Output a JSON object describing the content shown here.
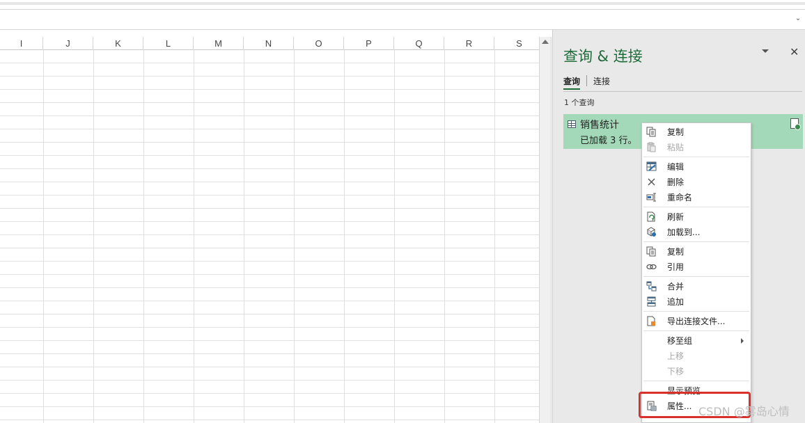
{
  "columns": [
    "I",
    "J",
    "K",
    "L",
    "M",
    "N",
    "O",
    "P",
    "Q",
    "R",
    "S"
  ],
  "pane": {
    "title": "查询 & 连接",
    "tab_queries": "查询",
    "tab_connections": "连接",
    "query_count": "1 个查询",
    "query": {
      "name": "销售统计",
      "status": "已加载 3 行。"
    }
  },
  "menu": {
    "copy": "复制",
    "paste": "粘贴",
    "edit": "编辑",
    "delete": "删除",
    "rename": "重命名",
    "refresh": "刷新",
    "load_to": "加载到...",
    "duplicate": "复制",
    "reference": "引用",
    "merge": "合并",
    "append": "追加",
    "export_connection": "导出连接文件...",
    "move_to_group": "移至组",
    "move_up": "上移",
    "move_down": "下移",
    "show_preview": "显示预览",
    "properties": "属性..."
  },
  "watermark": "CSDN @雾岛心情",
  "colors": {
    "accent_green": "#1f6b3a",
    "selected_query_bg": "#a3d9b8",
    "highlight_border": "#d9302c"
  }
}
